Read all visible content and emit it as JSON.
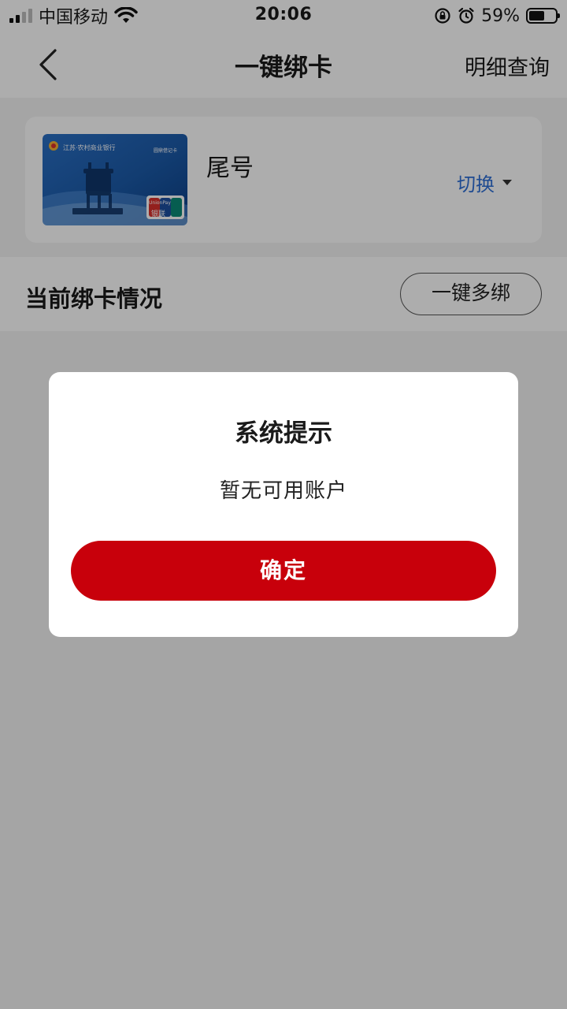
{
  "status_bar": {
    "carrier": "中国移动",
    "time": "20:06",
    "battery": "59%",
    "battery_level": 0.59
  },
  "nav": {
    "title": "一键绑卡",
    "right_action": "明细查询",
    "back_icon": "chevron-left-icon"
  },
  "card": {
    "tail_label": "尾号",
    "switch_label": "切换",
    "bank_name": "江苏·农村商业银行",
    "card_type": "圆鼎借记卡",
    "unionpay_en": "UnionPay",
    "unionpay_cn": "银联"
  },
  "binding": {
    "title": "当前绑卡情况",
    "multi_bind_button": "一键多绑"
  },
  "dialog": {
    "title": "系统提示",
    "message": "暂无可用账户",
    "confirm_button": "确定"
  },
  "colors": {
    "accent_red": "#c8000b",
    "link_blue": "#2f6fd6"
  }
}
